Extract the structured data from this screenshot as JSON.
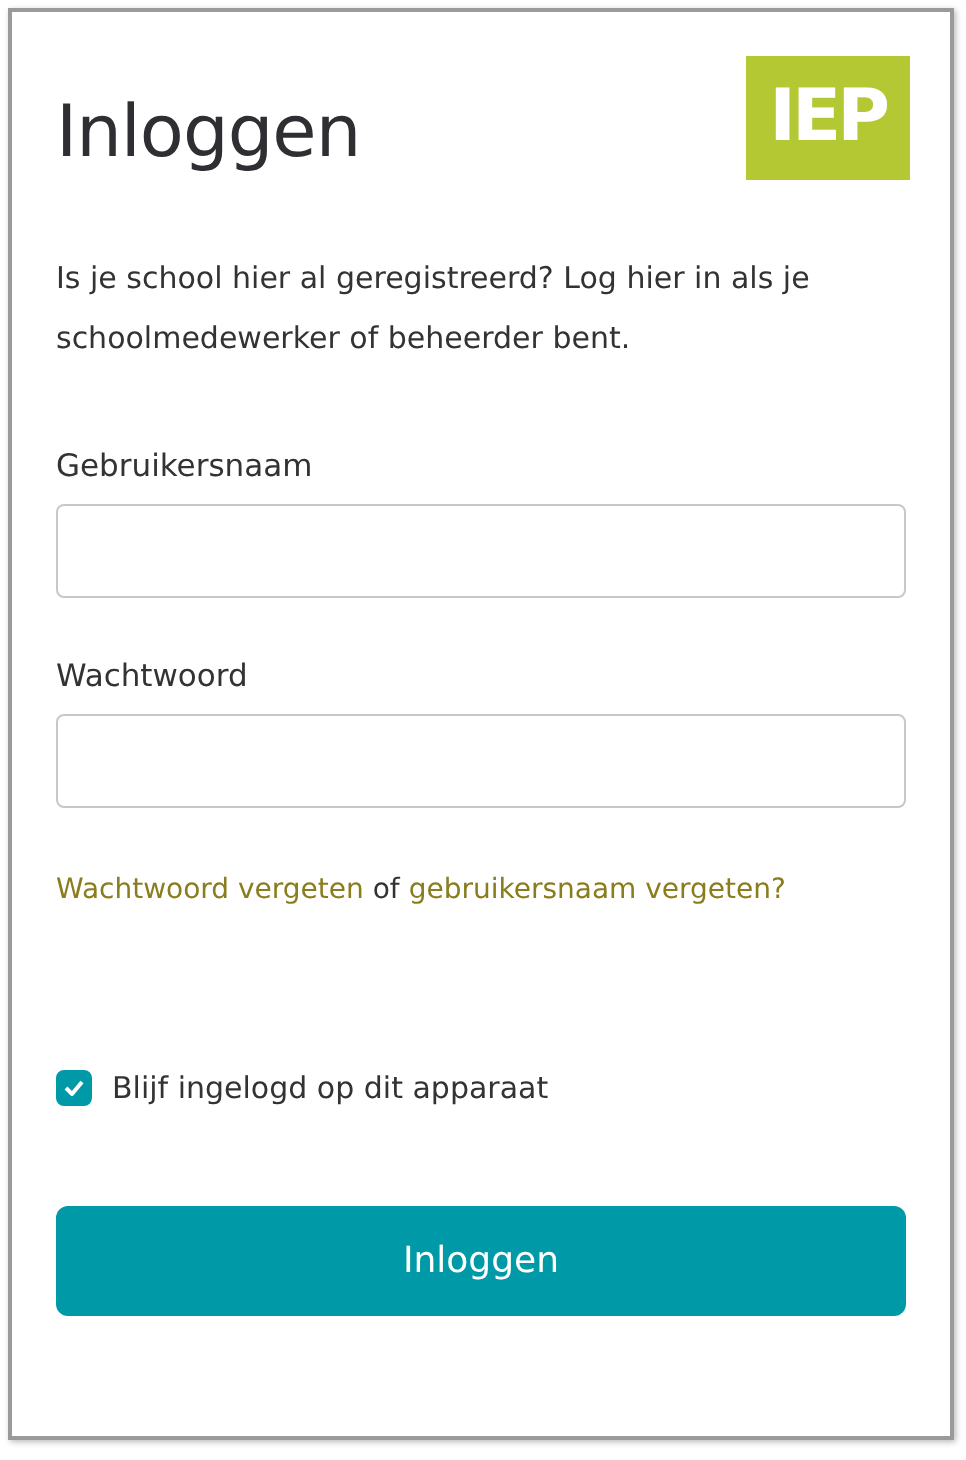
{
  "title": "Inloggen",
  "logo": {
    "text": "IEP"
  },
  "intro": "Is je school hier al geregistreerd? Log hier in als je schoolmedewerker of beheerder bent.",
  "fields": [
    {
      "label": "Gebruikersnaam"
    },
    {
      "label": "Wachtwoord"
    }
  ],
  "help": {
    "parts": [
      {
        "kind": "link",
        "text": "Wachtwoord vergeten"
      },
      {
        "kind": "text",
        "text": " of "
      },
      {
        "kind": "link",
        "text": "gebruikersnaam vergeten?"
      }
    ]
  },
  "remember": {
    "label": "Blijf ingelogd op dit apparaat",
    "checked": true
  },
  "submit": {
    "label": "Inloggen"
  }
}
